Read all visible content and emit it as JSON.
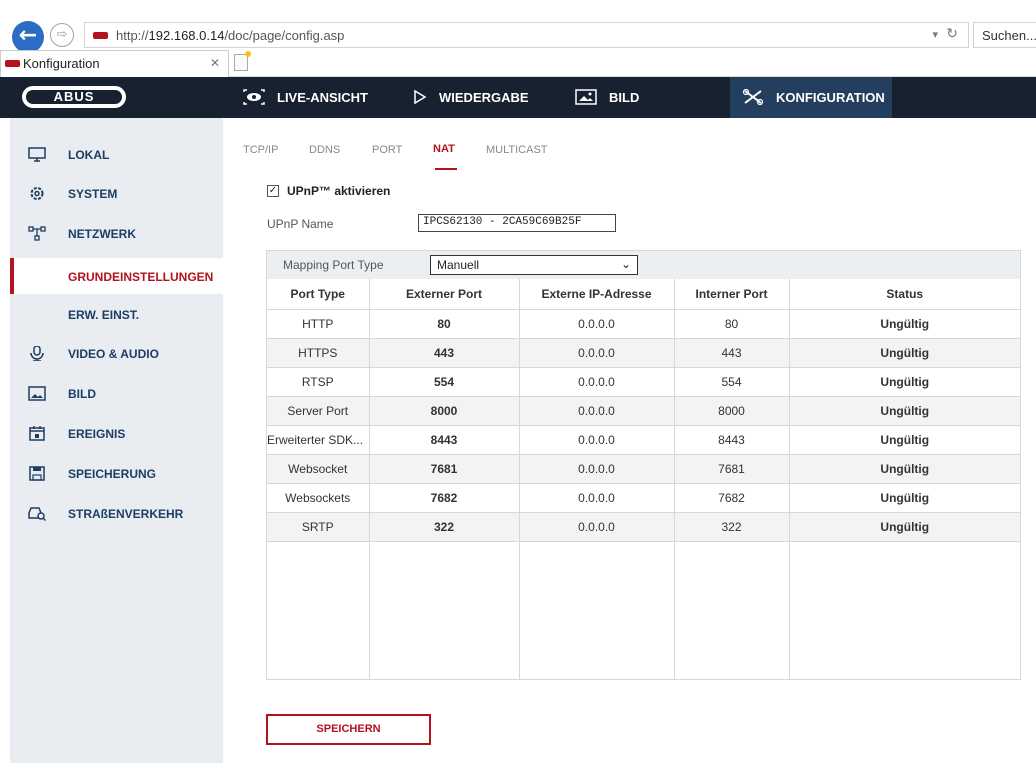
{
  "browser": {
    "url_prefix": "http://",
    "url_host": "192.168.0.14",
    "url_path": "/doc/page/config.asp",
    "search_placeholder": "Suchen...",
    "tab_title": "Konfiguration"
  },
  "header": {
    "logo": "ABUS",
    "nav": [
      {
        "label": "LIVE-ANSICHT",
        "icon": "eye-icon"
      },
      {
        "label": "WIEDERGABE",
        "icon": "play-icon"
      },
      {
        "label": "BILD",
        "icon": "image-icon"
      },
      {
        "label": "KONFIGURATION",
        "icon": "tools-icon"
      }
    ],
    "active": "KONFIGURATION",
    "colors": {
      "header_bg": "#17212f",
      "active_bg": "#243e60",
      "accent": "#b3121f"
    }
  },
  "sidebar": {
    "items": [
      {
        "label": "LOKAL",
        "icon": "monitor-icon"
      },
      {
        "label": "SYSTEM",
        "icon": "gear-icon"
      },
      {
        "label": "NETZWERK",
        "icon": "network-icon"
      },
      {
        "label": "GRUNDEINSTELLUNGEN",
        "icon": ""
      },
      {
        "label": "ERW. EINST.",
        "icon": ""
      },
      {
        "label": "VIDEO & AUDIO",
        "icon": "microphone-icon"
      },
      {
        "label": "BILD",
        "icon": "image-icon"
      },
      {
        "label": "EREIGNIS",
        "icon": "calendar-icon"
      },
      {
        "label": "SPEICHERUNG",
        "icon": "save-icon"
      },
      {
        "label": "STRAßENVERKEHR",
        "icon": "car-search-icon"
      }
    ],
    "active": "GRUNDEINSTELLUNGEN"
  },
  "subtabs": {
    "items": [
      "TCP/IP",
      "DDNS",
      "PORT",
      "NAT",
      "MULTICAST"
    ],
    "active": "NAT"
  },
  "upnp": {
    "enable_label": "UPnP™ aktivieren",
    "enabled": true,
    "name_label": "UPnP Name",
    "name_value": "IPCS62130 - 2CA59C69B25F"
  },
  "mapping": {
    "label": "Mapping Port Type",
    "value": "Manuell"
  },
  "table": {
    "headers": [
      "Port Type",
      "Externer Port",
      "Externe IP-Adresse",
      "Interner Port",
      "Status"
    ],
    "rows": [
      [
        "HTTP",
        "80",
        "0.0.0.0",
        "80",
        "Ungültig"
      ],
      [
        "HTTPS",
        "443",
        "0.0.0.0",
        "443",
        "Ungültig"
      ],
      [
        "RTSP",
        "554",
        "0.0.0.0",
        "554",
        "Ungültig"
      ],
      [
        "Server Port",
        "8000",
        "0.0.0.0",
        "8000",
        "Ungültig"
      ],
      [
        "Erweiterter SDK...",
        "8443",
        "0.0.0.0",
        "8443",
        "Ungültig"
      ],
      [
        "Websocket",
        "7681",
        "0.0.0.0",
        "7681",
        "Ungültig"
      ],
      [
        "Websockets",
        "7682",
        "0.0.0.0",
        "7682",
        "Ungültig"
      ],
      [
        "SRTP",
        "322",
        "0.0.0.0",
        "322",
        "Ungültig"
      ]
    ]
  },
  "save_label": "SPEICHERN"
}
